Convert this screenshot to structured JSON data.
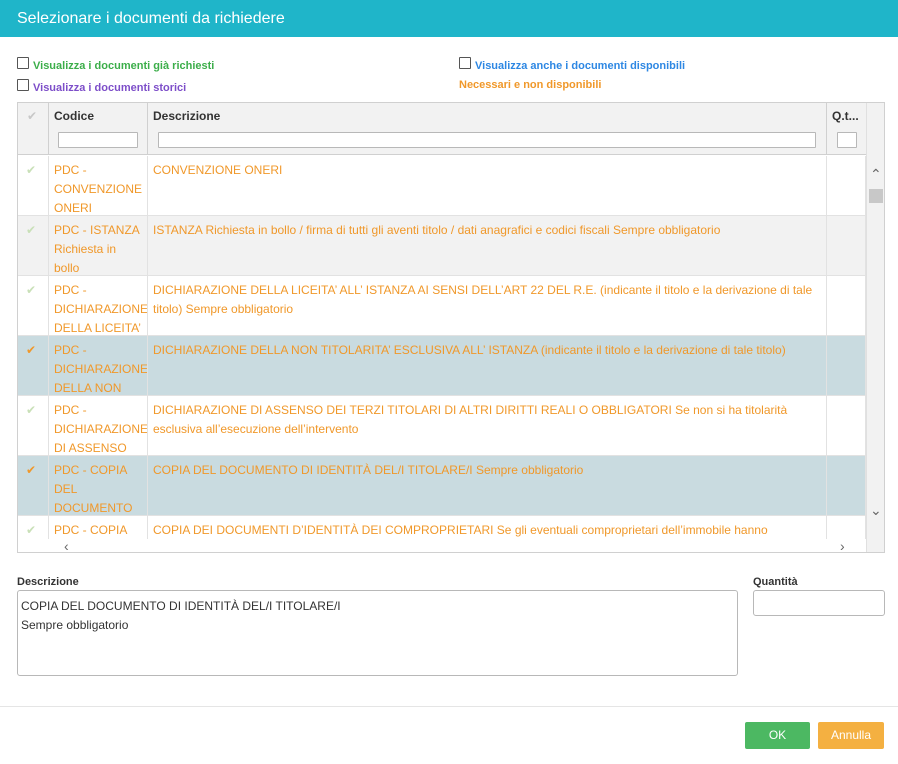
{
  "dialog": {
    "title": "Selezionare i documenti da richiedere"
  },
  "colors": {
    "header": "#1fb5c9",
    "green": "#3cae4a",
    "purple": "#7d4ec9",
    "blue": "#2d87e3",
    "orange": "#f0982a",
    "selected_row": "#c9dbe0",
    "alt_row": "#f2f2f2",
    "ok": "#4cb862",
    "cancel": "#f4b041"
  },
  "options": {
    "show_requested": "Visualizza i documenti già richiesti",
    "show_historic": "Visualizza i documenti storici",
    "show_available": "Visualizza anche i documenti disponibili",
    "legend_missing": "Necessari e non disponibili"
  },
  "table": {
    "columns": {
      "codice": "Codice",
      "descrizione": "Descrizione",
      "quantita": "Q.t..."
    },
    "rows": [
      {
        "codice": "PDC -\nCONVENZIONE\nONERI",
        "descrizione": "CONVENZIONE ONERI",
        "checked": false,
        "selected": false
      },
      {
        "codice": "PDC - ISTANZA\nRichiesta in\nbollo",
        "descrizione": "ISTANZA Richiesta in bollo / firma di tutti gli aventi titolo / dati anagrafici e codici fiscali Sempre obbligatorio",
        "checked": false,
        "selected": false
      },
      {
        "codice": "PDC -\nDICHIARAZIONE\nDELLA LICEITA’",
        "descrizione": "DICHIARAZIONE DELLA LICEITA’ ALL’ ISTANZA AI SENSI DELL’ART 22 DEL R.E. (indicante il titolo e la derivazione di tale titolo) Sempre obbligatorio",
        "checked": false,
        "selected": false
      },
      {
        "codice": "PDC -\nDICHIARAZIONE\nDELLA NON",
        "descrizione": "DICHIARAZIONE DELLA NON TITOLARITA’ ESCLUSIVA ALL’ ISTANZA (indicante il titolo e la derivazione di tale titolo)",
        "checked": true,
        "selected": true
      },
      {
        "codice": "PDC -\nDICHIARAZIONE\nDI ASSENSO",
        "descrizione": "DICHIARAZIONE DI ASSENSO DEI TERZI TITOLARI DI ALTRI DIRITTI REALI O OBBLIGATORI Se non si ha titolarità esclusiva all’esecuzione dell’intervento",
        "checked": false,
        "selected": false
      },
      {
        "codice": "PDC - COPIA\nDEL\nDOCUMENTO",
        "descrizione": "COPIA DEL DOCUMENTO DI IDENTITÀ DEL/I TITOLARE/I Sempre obbligatorio",
        "checked": true,
        "selected": true
      },
      {
        "codice": "PDC - COPIA",
        "descrizione": "COPIA DEI DOCUMENTI D’IDENTITÀ DEI COMPROPRIETARI Se gli eventuali comproprietari dell’immobile hanno",
        "checked": false,
        "selected": false
      }
    ]
  },
  "detail": {
    "descrizione_label": "Descrizione",
    "descrizione_value": "COPIA DEL DOCUMENTO DI IDENTITÀ DEL/I TITOLARE/I\nSempre obbligatorio",
    "quantita_label": "Quantità",
    "quantita_value": ""
  },
  "buttons": {
    "ok": "OK",
    "cancel": "Annulla"
  },
  "icons": {
    "check": "✔",
    "scroll_up": "⌃",
    "scroll_down": "⌄",
    "scroll_left": "‹",
    "scroll_right": "›"
  }
}
